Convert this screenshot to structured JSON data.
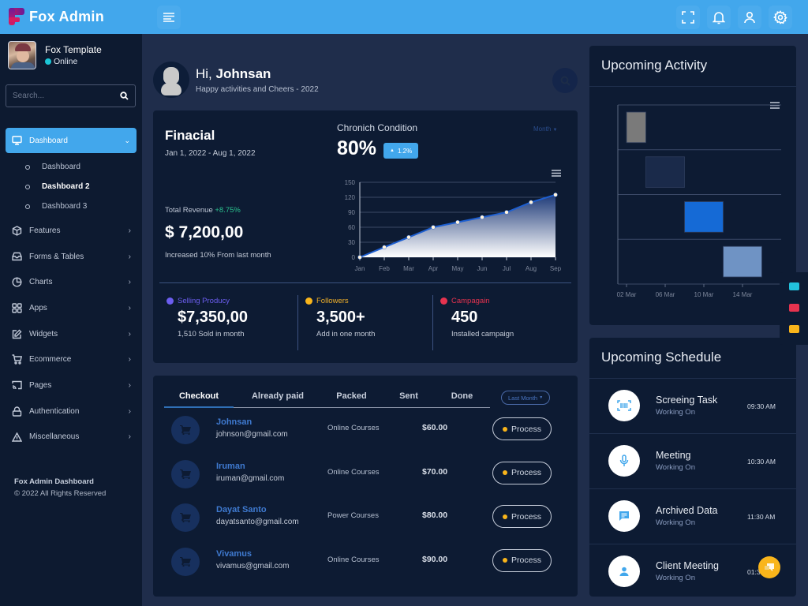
{
  "app": {
    "name": "Fox Admin"
  },
  "topbar": {
    "icons": [
      "menu-icon",
      "fullscreen-icon",
      "bell-icon",
      "user-icon",
      "gear-icon"
    ]
  },
  "sidebar": {
    "profile": {
      "name": "Fox Template",
      "status": "Online"
    },
    "search": {
      "placeholder": "Search..."
    },
    "active": {
      "label": "Dashboard",
      "icon": "monitor-icon"
    },
    "subitems": [
      {
        "label": "Dashboard",
        "active": false
      },
      {
        "label": "Dashboard 2",
        "active": true
      },
      {
        "label": "Dashboard 3",
        "active": false
      }
    ],
    "items": [
      {
        "label": "Features",
        "icon": "box-icon"
      },
      {
        "label": "Forms & Tables",
        "icon": "inbox-icon"
      },
      {
        "label": "Charts",
        "icon": "pie-chart-icon"
      },
      {
        "label": "Apps",
        "icon": "grid-icon"
      },
      {
        "label": "Widgets",
        "icon": "edit-icon"
      },
      {
        "label": "Ecommerce",
        "icon": "cart-icon"
      },
      {
        "label": "Pages",
        "icon": "cast-icon"
      },
      {
        "label": "Authentication",
        "icon": "lock-icon"
      },
      {
        "label": "Miscellaneous",
        "icon": "warning-icon"
      }
    ],
    "footer": {
      "title": "Fox Admin Dashboard",
      "copyright": "© 2022 All Rights Reserved"
    }
  },
  "greeting": {
    "hi": "Hi,",
    "name": "Johnsan",
    "subtitle": "Happy activities and Cheers - 2022"
  },
  "financial": {
    "title": "Finacial",
    "date_range": "Jan 1, 2022 - Aug 1, 2022",
    "revenue_label": "Total Revenue",
    "revenue_change": "+8.75%",
    "revenue_value": "$ 7,200,00",
    "revenue_note": "Increased 10% From last month",
    "condition_title": "Chronich Condition",
    "condition_value": "80%",
    "condition_badge": "1.2%",
    "period_dropdown": "Month",
    "stats": [
      {
        "label": "Selling Producy",
        "value": "$7,350,00",
        "sub": "1,510 Sold in month",
        "color": "#6c5ef0"
      },
      {
        "label": "Followers",
        "value": "3,500+",
        "sub": "Add in one month",
        "color": "#f9b51b"
      },
      {
        "label": "Campagain",
        "value": "450",
        "sub": "Installed campaign",
        "color": "#e6334f"
      }
    ]
  },
  "chart_data": [
    {
      "type": "area",
      "title": "Chronich Condition",
      "categories": [
        "Jan",
        "Feb",
        "Mar",
        "Apr",
        "May",
        "Jun",
        "Jul",
        "Aug",
        "Sep"
      ],
      "values": [
        0,
        20,
        40,
        60,
        70,
        80,
        90,
        110,
        125
      ],
      "yticks": [
        0,
        30,
        60,
        90,
        120,
        150
      ],
      "ylim": [
        0,
        150
      ],
      "grid": true,
      "line_color": "#1e5fd0"
    },
    {
      "type": "bar",
      "subtype": "gantt",
      "title": "Upcoming Activity",
      "xticks": [
        "02 Mar",
        "06 Mar",
        "10 Mar",
        "14 Mar"
      ],
      "xlim_days": [
        1.1,
        18
      ],
      "tasks": [
        {
          "start_day": 2,
          "end_day": 4,
          "color": "#7a7a7a"
        },
        {
          "start_day": 4,
          "end_day": 8,
          "color": "#1a2a4a"
        },
        {
          "start_day": 8,
          "end_day": 12,
          "color": "#156ad6"
        },
        {
          "start_day": 12,
          "end_day": 16,
          "color": "#6f93c4"
        }
      ],
      "grid": true
    }
  ],
  "orders": {
    "tabs": [
      "Checkout",
      "Already paid",
      "Packed",
      "Sent",
      "Done"
    ],
    "active_tab": 0,
    "filter": "Last Month",
    "rows": [
      {
        "name": "Johnsan",
        "email": "johnson@gmail.com",
        "course": "Online Courses",
        "price": "$60.00",
        "status": "Process"
      },
      {
        "name": "Iruman",
        "email": "iruman@gmail.com",
        "course": "Online Courses",
        "price": "$70.00",
        "status": "Process"
      },
      {
        "name": "Dayat Santo",
        "email": "dayatsanto@gmail.com",
        "course": "Power Courses",
        "price": "$80.00",
        "status": "Process"
      },
      {
        "name": "Vivamus",
        "email": "vivamus@gmail.com",
        "course": "Online Courses",
        "price": "$90.00",
        "status": "Process"
      }
    ]
  },
  "activity": {
    "title": "Upcoming Activity"
  },
  "schedule": {
    "title": "Upcoming Schedule",
    "items": [
      {
        "title": "Screeing Task",
        "sub": "Working On",
        "time": "09:30 AM",
        "icon": "barcode-scan-icon"
      },
      {
        "title": "Meeting",
        "sub": "Working On",
        "time": "10:30 AM",
        "icon": "microphone-icon"
      },
      {
        "title": "Archived Data",
        "sub": "Working On",
        "time": "11:30 AM",
        "icon": "message-icon"
      },
      {
        "title": "Client Meeting",
        "sub": "Working On",
        "time": "01:30 PM",
        "icon": "person-icon"
      }
    ]
  },
  "colors": {
    "accent": "#42a7ec",
    "panel": "#0d1b33",
    "background": "#1f2d4b",
    "success": "#2ac08e",
    "warning": "#f9b51b"
  }
}
